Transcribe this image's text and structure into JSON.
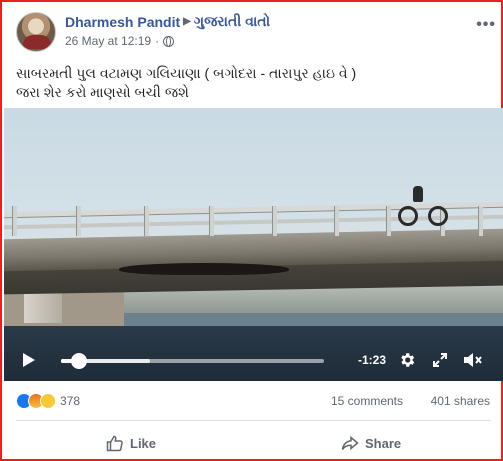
{
  "post": {
    "author": "Dharmesh Pandit",
    "group": "ગુજરાતી વાતો",
    "timestamp": "26 May at 12:19",
    "separator": "·",
    "text_line1": "સાબરમતી પુલ વટામણ ગલિયાણા ( બગોદરા - તારાપુર હાઇ વે )",
    "text_line2": "જરા શેર કરો માણસો બચી જશે"
  },
  "video": {
    "time_remaining": "-1:23",
    "progress_fraction": 0.07,
    "buffered_fraction": 0.34
  },
  "stats": {
    "reaction_count": "378",
    "comments": "15 comments",
    "shares": "401 shares"
  },
  "actions": {
    "like_label": "Like",
    "share_label": "Share"
  },
  "colors": {
    "link": "#385898",
    "border": "#e8231f",
    "like_blue": "#1877f2"
  },
  "icons": [
    "globe-icon",
    "more-icon",
    "play-icon",
    "gear-icon",
    "expand-icon",
    "mute-icon",
    "like-icon",
    "share-icon"
  ]
}
